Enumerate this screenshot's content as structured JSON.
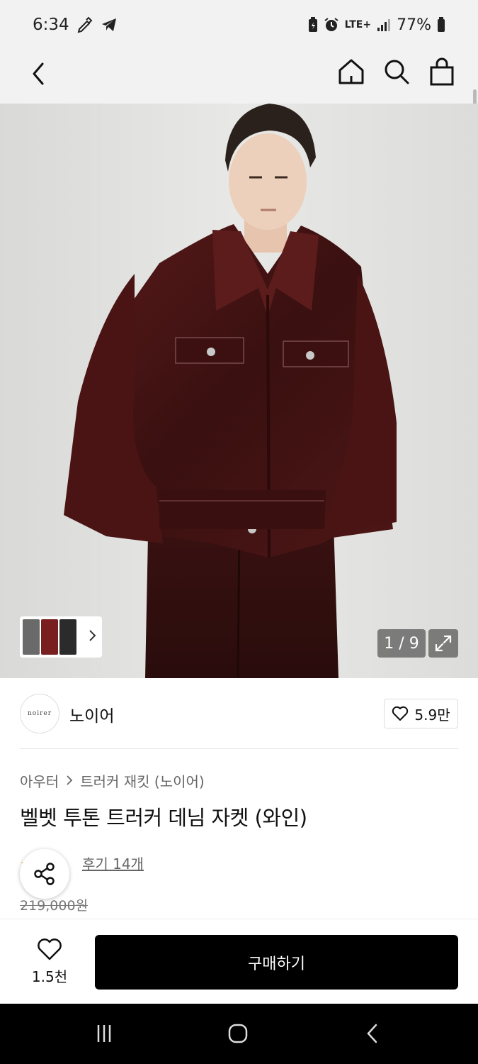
{
  "status_bar": {
    "time": "6:34",
    "network": "LTE+",
    "battery": "77%",
    "icons": [
      "pencil-icon",
      "telegram-icon",
      "battery-saver-icon",
      "alarm-icon",
      "lte-icon",
      "signal-icon",
      "battery-icon"
    ]
  },
  "top_nav": {
    "icons": [
      "back-icon",
      "home-icon",
      "search-icon",
      "shopping-bag-icon"
    ]
  },
  "gallery": {
    "page_counter": "1 / 9",
    "current_page": 1,
    "total_pages": 9,
    "icons": [
      "chevron-right-icon",
      "expand-icon"
    ]
  },
  "brand": {
    "logo_text": "noirer",
    "name": "노이어",
    "likes": "5.9만"
  },
  "product": {
    "breadcrumb": [
      "아우터",
      "트러커 재킷 (노이어)"
    ],
    "title": "벨벳 투톤 트러커 데님 자켓 (와인)",
    "reviews": "후기 14개",
    "original_price": "219,000원"
  },
  "purchase_bar": {
    "wish_count": "1.5천",
    "buy_label": "구매하기"
  },
  "colors": {
    "accent": "#000000",
    "star": "#f5b400",
    "header_bg": "#f2f2f2",
    "jacket": "#4a1414"
  }
}
